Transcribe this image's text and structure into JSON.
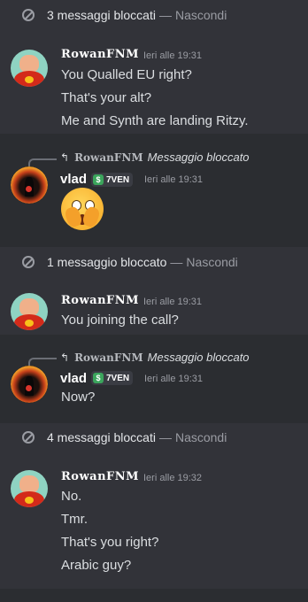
{
  "groups": [
    {
      "blocked": "3 messaggi bloccati",
      "sep": "—",
      "hide": "Nascondi",
      "user": "RowanFNM",
      "time": "Ieri alle 19:31",
      "messages": [
        "You Qualled EU right?",
        "That's your alt?",
        "Me and Synth are landing Ritzy."
      ]
    },
    {
      "reply_user": "RowanFNM",
      "reply_text": "Messaggio bloccato",
      "user": "vlad",
      "tag": "7VEN",
      "time": "Ieri alle 19:31"
    },
    {
      "blocked": "1 messaggio bloccato",
      "sep": "—",
      "hide": "Nascondi",
      "user": "RowanFNM",
      "time": "Ieri alle 19:31",
      "messages": [
        "You joining the call?"
      ]
    },
    {
      "reply_user": "RowanFNM",
      "reply_text": "Messaggio bloccato",
      "user": "vlad",
      "tag": "7VEN",
      "time": "Ieri alle 19:31",
      "messages": [
        "Now?"
      ]
    },
    {
      "blocked": "4 messaggi bloccati",
      "sep": "—",
      "hide": "Nascondi",
      "user": "RowanFNM",
      "time": "Ieri alle 19:32",
      "messages": [
        "No.",
        "Tmr.",
        "That's you right?",
        "Arabic guy?"
      ]
    }
  ],
  "icons": {
    "blocked": "block-icon",
    "reply": "reply-arrow-icon",
    "tag": "dollar-tag-icon",
    "emoji": "face-with-hand-over-mouth-emoji"
  },
  "colors": {
    "background": "#323339",
    "highlight": "#2b2d31",
    "tag_green": "#3ba55c"
  }
}
